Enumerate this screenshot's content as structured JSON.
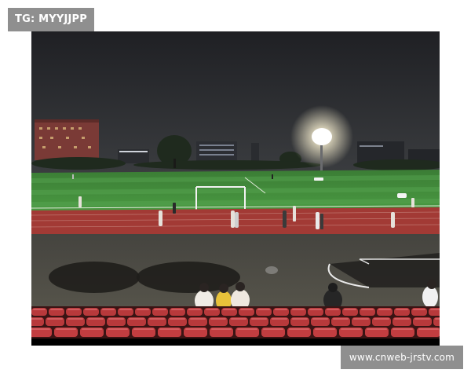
{
  "watermark_top": {
    "text": "TG: MYYJJPP"
  },
  "watermark_bottom": {
    "text": "www.cnweb-jrstv.com"
  },
  "photo": {
    "subject": "night-football-field",
    "colors": {
      "sky": "#2b2d31",
      "field": "#3f8a3a",
      "track": "#a23a35",
      "seats": "#b8393b",
      "concourse": "#4b4a43",
      "floodlight": "#ffffff"
    }
  }
}
